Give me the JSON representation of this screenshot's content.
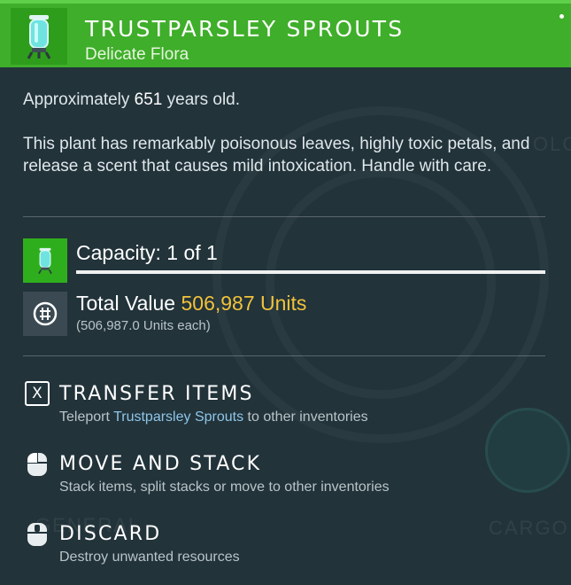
{
  "item": {
    "title": "TRUSTPARSLEY SPROUTS",
    "subtitle": "Delicate Flora",
    "age_prefix": "Approximately ",
    "age_value": "651",
    "age_suffix": " years old.",
    "description": "This plant has remarkably poisonous leaves, highly toxic petals, and release a scent that causes mild intoxication. Handle with care."
  },
  "capacity": {
    "label": "Capacity: 1 of 1",
    "fill_fraction": 1.0
  },
  "value": {
    "label": "Total Value ",
    "amount": "506,987 Units",
    "each": "(506,987.0 Units each)"
  },
  "actions": [
    {
      "key": "X",
      "title": "TRANSFER ITEMS",
      "desc_prefix": "Teleport ",
      "desc_highlight": "Trustparsley Sprouts",
      "desc_suffix": " to other inventories"
    },
    {
      "title": "MOVE AND STACK",
      "desc": "Stack items, split stacks or move to other inventories"
    },
    {
      "title": "DISCARD",
      "desc": "Destroy unwanted resources"
    }
  ],
  "background_text": [
    "OLO",
    "GENERAL",
    "CARGO"
  ],
  "colors": {
    "header": "#3fae2a",
    "accent_value": "#f2c23a",
    "highlight": "#8fc6e8"
  }
}
